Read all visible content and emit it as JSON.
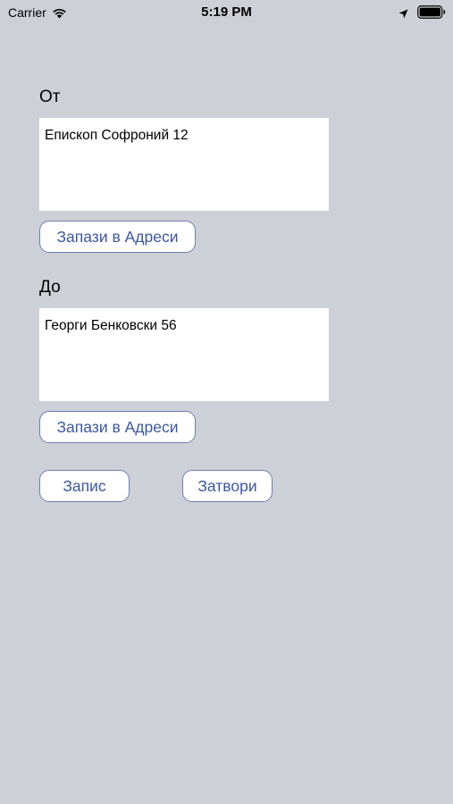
{
  "status_bar": {
    "carrier": "Carrier",
    "time": "5:19 PM",
    "icons": [
      "wifi-icon",
      "location-icon",
      "battery-icon"
    ]
  },
  "from": {
    "label": "От",
    "value": "Епископ Софроний 12",
    "save_button": "Запази в Адреси"
  },
  "to": {
    "label": "До",
    "value": "Георги Бенковски 56",
    "save_button": "Запази в Адреси"
  },
  "actions": {
    "save": "Запис",
    "close": "Затвори"
  },
  "colors": {
    "background": "#cdd0d6",
    "button_text": "#3a57a4",
    "button_border": "#6d7fb3"
  }
}
